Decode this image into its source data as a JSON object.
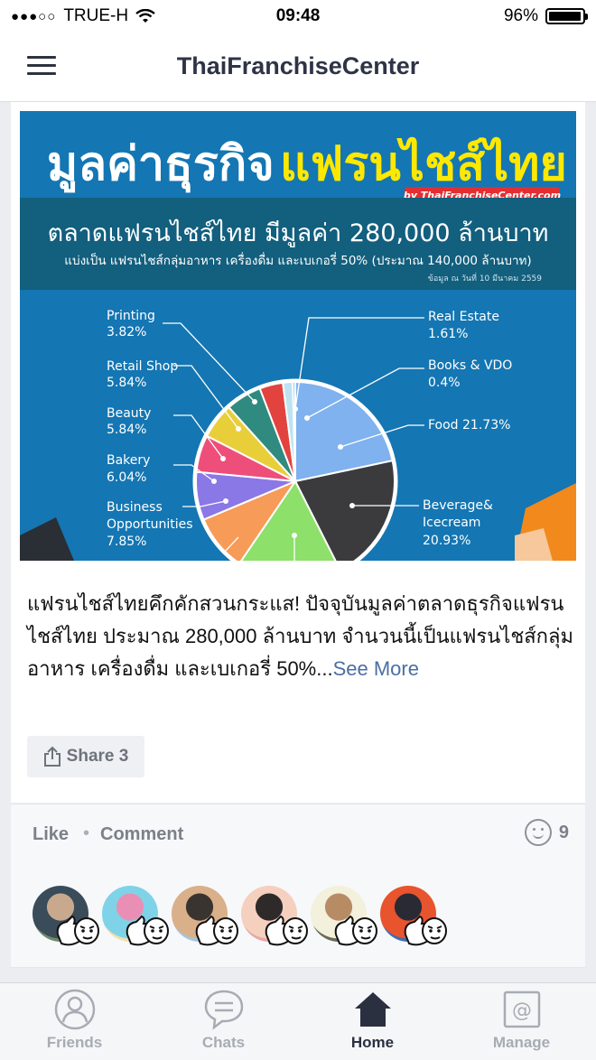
{
  "status_bar": {
    "carrier": "TRUE-H",
    "time": "09:48",
    "battery": "96%",
    "battery_level": 0.96
  },
  "header": {
    "title": "ThaiFranchiseCenter"
  },
  "post": {
    "image": {
      "title_part1": "มูลค่าธุรกิจ",
      "title_part2": "แฟรนไชส์ไทย",
      "credit": "by ThaiFranchiseCenter.com",
      "headline": "ตลาดแฟรนไชส์ไทย มีมูลค่า 280,000 ล้านบาท",
      "subline": "แบ่งเป็น แฟรนไชส์กลุ่มอาหาร เครื่องดื่ม และเบเกอรี่ 50% (ประมาณ 140,000 ล้านบาท)",
      "note": "ข้อมูล ณ วันที่ 10 มีนาคม 2559"
    },
    "text": "แฟรนไชส์ไทยคึกคักสวนกระแส! ปัจจุบันมูลค่าตลาดธุรกิจแฟรนไชส์ไทย ประมาณ 280,000 ล้านบาท จำนวนนี้เป็นแฟรนไชส์กลุ่มอาหาร เครื่องดื่ม และเบเกอรี่ 50%...",
    "see_more": "See More",
    "share_label": "Share 3",
    "like_label": "Like",
    "comment_label": "Comment",
    "reaction_count": "9"
  },
  "chart_data": {
    "type": "pie",
    "title": "",
    "series": [
      {
        "name": "Food",
        "value": 21.73,
        "label": "Food 21.73%",
        "color": "#7fb2ee"
      },
      {
        "name": "Beverage& Icecream",
        "value": 20.93,
        "label": "20.93%",
        "color": "#3b3b3e"
      },
      {
        "name": "(unlabeled)",
        "value": 17.0,
        "color": "#8de06a"
      },
      {
        "name": "(unlabeled)",
        "value": 9.2,
        "color": "#f79b58"
      },
      {
        "name": "Business Opportunities",
        "value": 7.85,
        "label": "7.85%",
        "color": "#8a78e6"
      },
      {
        "name": "Bakery",
        "value": 6.04,
        "label": "6.04%",
        "color": "#ee4f7a"
      },
      {
        "name": "Beauty",
        "value": 5.84,
        "label": "5.84%",
        "color": "#e8cf3a"
      },
      {
        "name": "Retail Shop",
        "value": 5.84,
        "label": "5.84%",
        "color": "#2f8a7f"
      },
      {
        "name": "Printing",
        "value": 3.82,
        "label": "3.82%",
        "color": "#e2433e"
      },
      {
        "name": "Real Estate",
        "value": 1.61,
        "label": "1.61%",
        "color": "#bde3f2"
      },
      {
        "name": "Books & VDO",
        "value": 0.4,
        "label": "0.4%",
        "color": "#5bb3d6"
      }
    ]
  },
  "chart_labels": {
    "printing": [
      "Printing",
      "3.82%"
    ],
    "retail": [
      "Retail Shop",
      "5.84%"
    ],
    "beauty": [
      "Beauty",
      "5.84%"
    ],
    "bakery": [
      "Bakery",
      "6.04%"
    ],
    "business": [
      "Business",
      "Opportunities",
      "7.85%"
    ],
    "real_estate": [
      "Real Estate",
      "1.61%"
    ],
    "books": [
      "Books & VDO",
      "0.4%"
    ],
    "food": "Food 21.73%",
    "beverage": [
      "Beverage&",
      "Icecream",
      "20.93%"
    ]
  },
  "tabs": [
    {
      "label": "Friends",
      "icon": "friends-icon",
      "active": false
    },
    {
      "label": "Chats",
      "icon": "chats-icon",
      "active": false
    },
    {
      "label": "Home",
      "icon": "home-icon",
      "active": true
    },
    {
      "label": "Manage",
      "icon": "manage-icon",
      "active": false
    }
  ],
  "colors": {
    "accent": "#2b3040",
    "link": "#4a6fa5",
    "banner_bg": "#1476b3",
    "banner_title_yellow": "#ffe800"
  }
}
